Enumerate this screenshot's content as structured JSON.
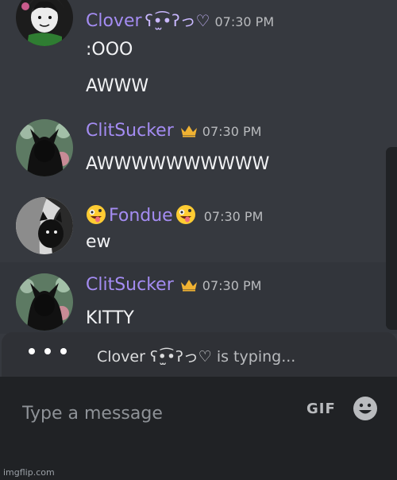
{
  "messages": [
    {
      "username": "Clover",
      "decoration": "ʕ•̫͡•ʔっ♡",
      "time": "07:30 PM",
      "lines": [
        ":OOO",
        "AWWW"
      ]
    },
    {
      "username": "ClitSucker",
      "badge": "crown-icon",
      "time": "07:30 PM",
      "lines": [
        "AWWWWWWWWWW"
      ]
    },
    {
      "username": "Fondue",
      "emoji": "zany-face-emoji",
      "time": "07:30 PM",
      "lines": [
        "ew"
      ]
    },
    {
      "username": "ClitSucker",
      "badge": "crown-icon",
      "time": "07:30 PM",
      "lines": [
        "KITTY"
      ]
    }
  ],
  "typing": {
    "name": "Clover ʕ•̫͡•ʔっ♡",
    "suffix": "is typing..."
  },
  "composer": {
    "placeholder": "Type a message",
    "gif_label": "GIF",
    "emoji_icon": "smile-icon"
  },
  "watermark": "imgflip.com",
  "colors": {
    "background": "#36393f",
    "username": "#a48cf2",
    "timestamp": "#b9bbbe",
    "composer": "#202225",
    "crown": "#f0b232"
  }
}
